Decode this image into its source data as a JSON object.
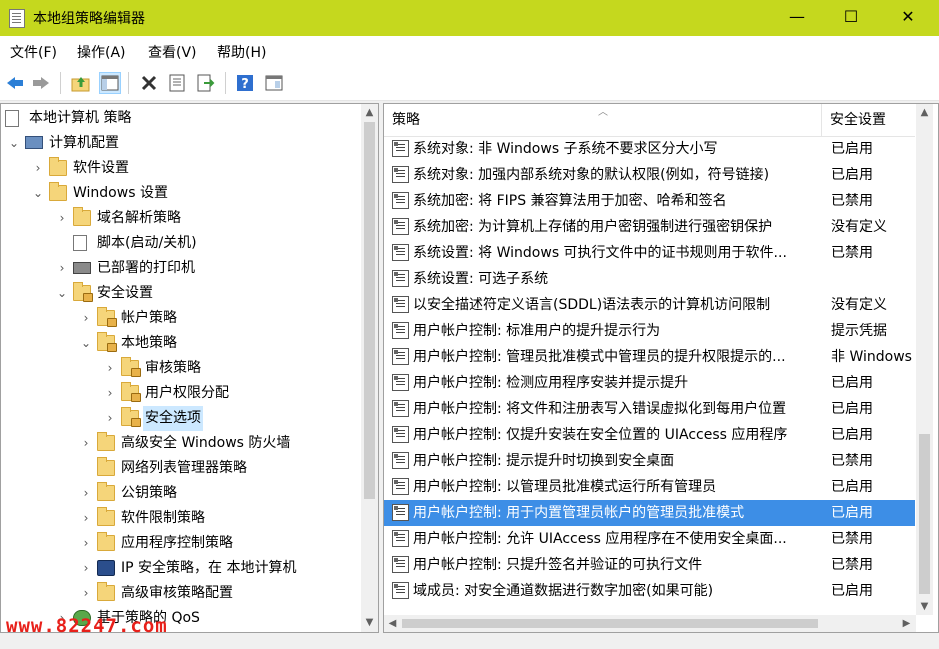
{
  "window": {
    "title": "本地组策略编辑器",
    "minimize": "—",
    "maximize": "☐",
    "close": "✕"
  },
  "menu": [
    "文件(F)",
    "操作(A)",
    "查看(V)",
    "帮助(H)"
  ],
  "toolbar": [
    "back-icon",
    "forward-icon",
    "up-folder-icon",
    "show-tree-icon",
    "delete-icon",
    "properties-icon",
    "export-icon",
    "help-icon",
    "view-icon"
  ],
  "tree": [
    {
      "label": "本地计算机 策略",
      "chev": ""
    },
    {
      "label": "计算机配置",
      "chev": "⌄"
    },
    {
      "label": "软件设置",
      "chev": "›"
    },
    {
      "label": "Windows 设置",
      "chev": "⌄"
    },
    {
      "label": "域名解析策略",
      "chev": "›"
    },
    {
      "label": "脚本(启动/关机)",
      "chev": ""
    },
    {
      "label": "已部署的打印机",
      "chev": "›"
    },
    {
      "label": "安全设置",
      "chev": "⌄"
    },
    {
      "label": "帐户策略",
      "chev": "›"
    },
    {
      "label": "本地策略",
      "chev": "⌄"
    },
    {
      "label": "审核策略",
      "chev": "›"
    },
    {
      "label": "用户权限分配",
      "chev": "›"
    },
    {
      "label": "安全选项",
      "chev": "›"
    },
    {
      "label": "高级安全 Windows 防火墙",
      "chev": "›"
    },
    {
      "label": "网络列表管理器策略",
      "chev": ""
    },
    {
      "label": "公钥策略",
      "chev": "›"
    },
    {
      "label": "软件限制策略",
      "chev": "›"
    },
    {
      "label": "应用程序控制策略",
      "chev": "›"
    },
    {
      "label": "IP 安全策略，在 本地计算机",
      "chev": "›"
    },
    {
      "label": "高级审核策略配置",
      "chev": "›"
    },
    {
      "label": "基于策略的 QoS",
      "chev": "›"
    }
  ],
  "list": {
    "col_policy": "策略",
    "col_setting": "安全设置",
    "rows": [
      {
        "policy": "系统对象: 非 Windows 子系统不要求区分大小写",
        "setting": "已启用"
      },
      {
        "policy": "系统对象: 加强内部系统对象的默认权限(例如，符号链接)",
        "setting": "已启用"
      },
      {
        "policy": "系统加密: 将 FIPS 兼容算法用于加密、哈希和签名",
        "setting": "已禁用"
      },
      {
        "policy": "系统加密: 为计算机上存储的用户密钥强制进行强密钥保护",
        "setting": "没有定义"
      },
      {
        "policy": "系统设置: 将 Windows 可执行文件中的证书规则用于软件...",
        "setting": "已禁用"
      },
      {
        "policy": "系统设置: 可选子系统",
        "setting": ""
      },
      {
        "policy": "以安全描述符定义语言(SDDL)语法表示的计算机访问限制",
        "setting": "没有定义"
      },
      {
        "policy": "用户帐户控制: 标准用户的提升提示行为",
        "setting": "提示凭据"
      },
      {
        "policy": "用户帐户控制: 管理员批准模式中管理员的提升权限提示的...",
        "setting": "非 Windows"
      },
      {
        "policy": "用户帐户控制: 检测应用程序安装并提示提升",
        "setting": "已启用"
      },
      {
        "policy": "用户帐户控制: 将文件和注册表写入错误虚拟化到每用户位置",
        "setting": "已启用"
      },
      {
        "policy": "用户帐户控制: 仅提升安装在安全位置的 UIAccess 应用程序",
        "setting": "已启用"
      },
      {
        "policy": "用户帐户控制: 提示提升时切换到安全桌面",
        "setting": "已禁用"
      },
      {
        "policy": "用户帐户控制: 以管理员批准模式运行所有管理员",
        "setting": "已启用"
      },
      {
        "policy": "用户帐户控制: 用于内置管理员帐户的管理员批准模式",
        "setting": "已启用"
      },
      {
        "policy": "用户帐户控制: 允许 UIAccess 应用程序在不使用安全桌面...",
        "setting": "已禁用"
      },
      {
        "policy": "用户帐户控制: 只提升签名并验证的可执行文件",
        "setting": "已禁用"
      },
      {
        "policy": "域成员: 对安全通道数据进行数字加密(如果可能)",
        "setting": "已启用"
      }
    ]
  },
  "watermark": "www.82247.com"
}
